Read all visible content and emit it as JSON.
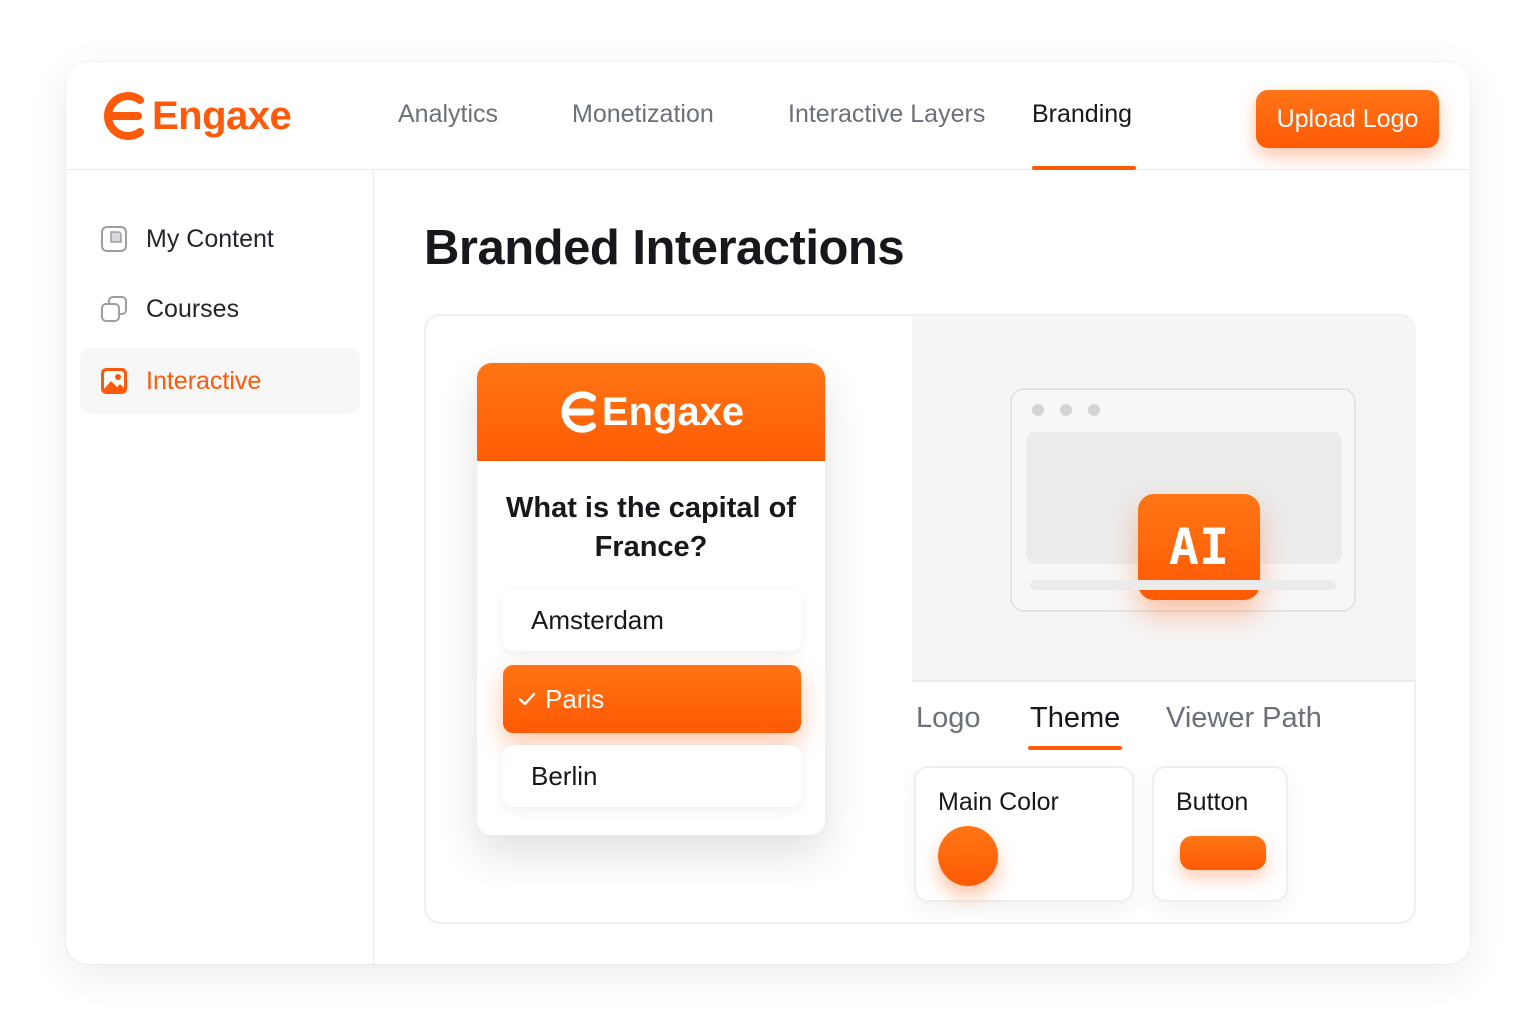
{
  "brand": {
    "name": "Engaxe",
    "accent_color": "#ff5a0a",
    "logo_icon": "engaxe-e-icon"
  },
  "header": {
    "nav": [
      {
        "label": "Analytics",
        "active": false
      },
      {
        "label": "Monetization",
        "active": false
      },
      {
        "label": "Interactive Layers",
        "active": false
      },
      {
        "label": "Branding",
        "active": true
      }
    ],
    "upload_label": "Upload Logo"
  },
  "sidebar": {
    "items": [
      {
        "label": "My Content",
        "icon": "content-icon",
        "active": false
      },
      {
        "label": "Courses",
        "icon": "courses-icon",
        "active": false
      },
      {
        "label": "Interactive",
        "icon": "interactive-image-icon",
        "active": true
      }
    ]
  },
  "main": {
    "title": "Branded Interactions",
    "quiz": {
      "brand": "Engaxe",
      "question": "What is the capital of France?",
      "options": [
        {
          "label": "Amsterdam",
          "selected": false
        },
        {
          "label": "Paris",
          "selected": true
        },
        {
          "label": "Berlin",
          "selected": false
        }
      ],
      "check_icon": "check-icon"
    },
    "preview": {
      "badge": "AI"
    },
    "tabs": [
      {
        "label": "Logo",
        "active": false
      },
      {
        "label": "Theme",
        "active": true
      },
      {
        "label": "Viewer Path",
        "active": false
      }
    ],
    "settings": {
      "main_color_label": "Main Color",
      "main_color": "#ff6a10",
      "button_label": "Button",
      "button_color": "#ff6a10"
    }
  }
}
